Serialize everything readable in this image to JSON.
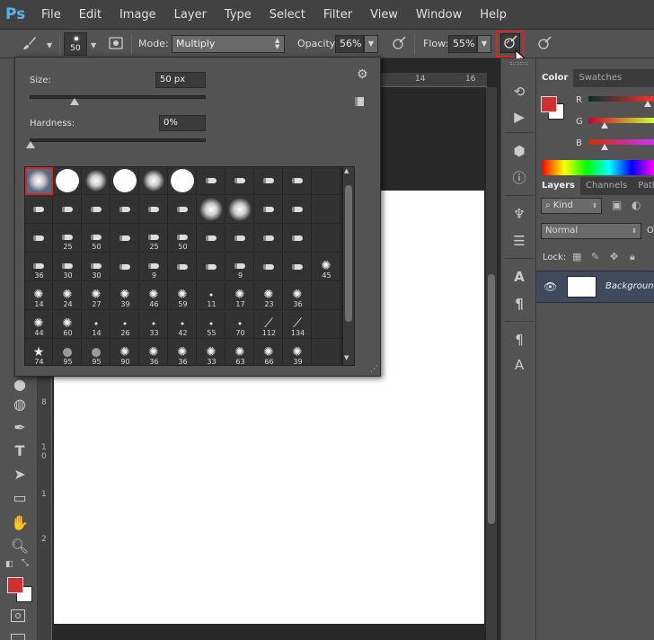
{
  "menubar": {
    "logo": "Ps",
    "items": [
      "File",
      "Edit",
      "Image",
      "Layer",
      "Type",
      "Select",
      "Filter",
      "View",
      "Window",
      "Help"
    ]
  },
  "options": {
    "brush_size": "50",
    "mode_label": "Mode:",
    "mode_value": "Multiply",
    "opacity_label": "Opacity:",
    "opacity_value": "56%",
    "flow_label": "Flow:",
    "flow_value": "55%"
  },
  "rulers": {
    "top": [
      "14",
      "16"
    ],
    "left": [
      "8",
      "1",
      "0",
      "1",
      "2"
    ]
  },
  "brush_popup": {
    "size_label": "Size:",
    "size_value": "50 px",
    "hardness_label": "Hardness:",
    "hardness_value": "0%",
    "size_slider_fraction": 0.25,
    "hardness_slider_fraction": 0.0,
    "rows": [
      [
        "",
        "",
        "",
        "",
        "",
        "",
        "",
        "",
        "",
        "",
        ""
      ],
      [
        "",
        "",
        "",
        "",
        "",
        "",
        "",
        "",
        "",
        "",
        ""
      ],
      [
        "",
        "25",
        "50",
        "",
        "25",
        "50",
        "",
        "",
        "",
        "",
        ""
      ],
      [
        "36",
        "30",
        "30",
        "",
        "9",
        "",
        "",
        "9",
        "",
        "",
        "45"
      ],
      [
        "14",
        "24",
        "27",
        "39",
        "46",
        "59",
        "11",
        "17",
        "23",
        "36",
        ""
      ],
      [
        "44",
        "60",
        "14",
        "26",
        "33",
        "42",
        "55",
        "70",
        "112",
        "134",
        ""
      ],
      [
        "74",
        "95",
        "95",
        "90",
        "36",
        "36",
        "33",
        "63",
        "66",
        "39",
        ""
      ]
    ]
  },
  "color_panel": {
    "tabs": [
      "Color",
      "Swatches"
    ],
    "channels": [
      "R",
      "G",
      "B"
    ],
    "fg_color": "#d03030",
    "bg_color": "#ffffff"
  },
  "layers_panel": {
    "tabs": [
      "Layers",
      "Channels",
      "Paths"
    ],
    "kind_label": "Kind",
    "blend_mode": "Normal",
    "opacity_abbrev": "O",
    "lock_label": "Lock:",
    "layer_name": "Background"
  },
  "colors": {
    "accent": "#5ab4ea",
    "highlight": "#cc2a2a"
  }
}
